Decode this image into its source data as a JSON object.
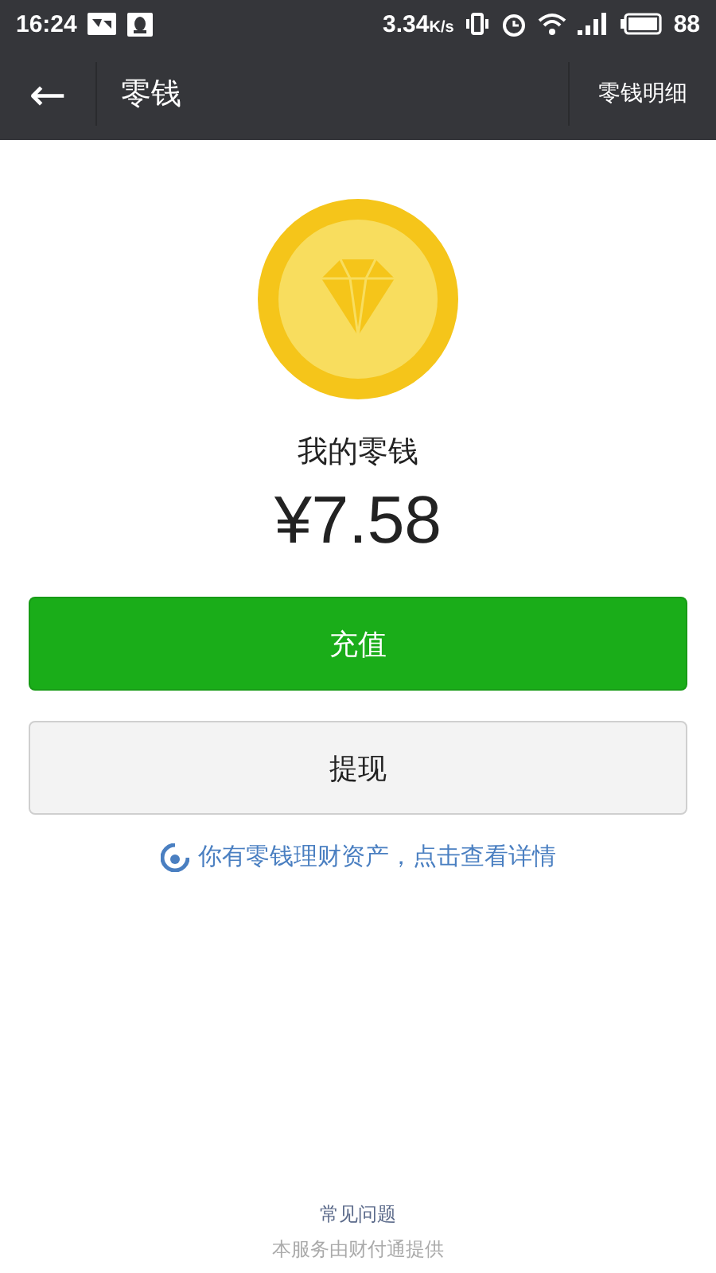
{
  "status_bar": {
    "time": "16:24",
    "speed": "3.34",
    "speed_unit": "K/s",
    "battery": "88"
  },
  "header": {
    "back": "←",
    "title": "零钱",
    "action": "零钱明细"
  },
  "balance": {
    "label": "我的零钱",
    "amount": "¥7.58"
  },
  "buttons": [
    {
      "label": "充值",
      "kind": "primary"
    },
    {
      "label": "提现",
      "kind": "secondary"
    }
  ],
  "notice": "你有零钱理财资产，点击查看详情",
  "footer": {
    "link": "常见问题",
    "provider": "本服务由财付通提供"
  }
}
